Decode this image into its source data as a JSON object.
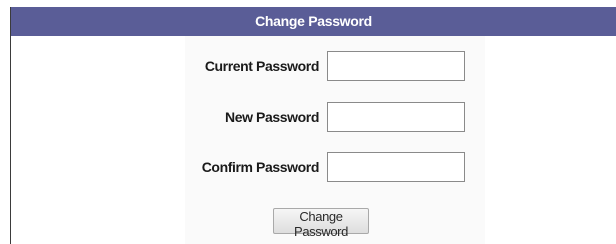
{
  "form": {
    "title": "Change Password",
    "fields": [
      {
        "label": "Current Password",
        "value": "",
        "placeholder": ""
      },
      {
        "label": "New Password",
        "value": "",
        "placeholder": ""
      },
      {
        "label": "Confirm Password",
        "value": "",
        "placeholder": ""
      }
    ],
    "submit_label": "Change Password"
  },
  "colors": {
    "header_background": "#5a5d97",
    "header_text": "#ffffff",
    "form_background": "#fafafa"
  }
}
